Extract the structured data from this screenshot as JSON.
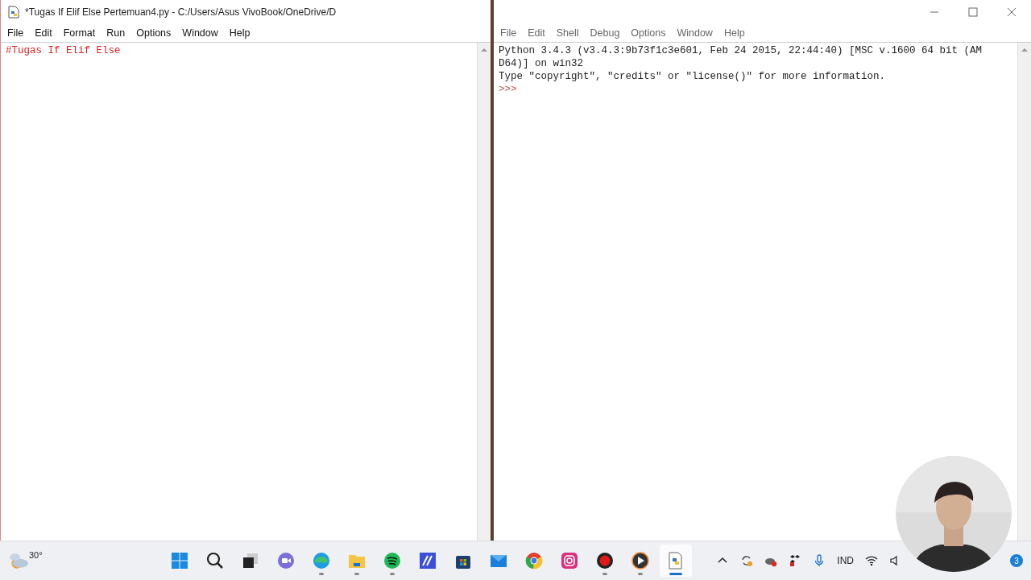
{
  "editor_window": {
    "title": "*Tugas If Elif Else Pertemuan4.py - C:/Users/Asus VivoBook/OneDrive/D",
    "menu": [
      "File",
      "Edit",
      "Format",
      "Run",
      "Options",
      "Window",
      "Help"
    ],
    "lines": [
      "#Tugas If Elif Else"
    ]
  },
  "shell_window": {
    "menu": [
      "File",
      "Edit",
      "Shell",
      "Debug",
      "Options",
      "Window",
      "Help"
    ],
    "lines": [
      {
        "kind": "output",
        "text": "Python 3.4.3 (v3.4.3:9b73f1c3e601, Feb 24 2015, 22:44:40) [MSC v.1600 64 bit (AM"
      },
      {
        "kind": "output",
        "text": "D64)] on win32"
      },
      {
        "kind": "output",
        "text": "Type \"copyright\", \"credits\" or \"license()\" for more information."
      },
      {
        "kind": "prompt",
        "text": ">>>"
      }
    ]
  },
  "taskbar": {
    "weather": "30°",
    "apps": [
      {
        "kind": "start",
        "running": false,
        "selected": false
      },
      {
        "kind": "search",
        "running": false,
        "selected": false
      },
      {
        "kind": "taskview",
        "running": false,
        "selected": false
      },
      {
        "kind": "chat",
        "running": false,
        "selected": false
      },
      {
        "kind": "edge",
        "running": true,
        "selected": false
      },
      {
        "kind": "folder",
        "running": true,
        "selected": false
      },
      {
        "kind": "spotify",
        "running": true,
        "selected": false
      },
      {
        "kind": "editor",
        "running": false,
        "selected": false
      },
      {
        "kind": "store",
        "running": false,
        "selected": false
      },
      {
        "kind": "mail",
        "running": false,
        "selected": false
      },
      {
        "kind": "chrome",
        "running": false,
        "selected": false
      },
      {
        "kind": "instagram",
        "running": false,
        "selected": false
      },
      {
        "kind": "record",
        "running": true,
        "selected": false
      },
      {
        "kind": "player",
        "running": true,
        "selected": false
      },
      {
        "kind": "python",
        "running": true,
        "selected": true
      }
    ],
    "language": "IND",
    "notifications": "3"
  }
}
